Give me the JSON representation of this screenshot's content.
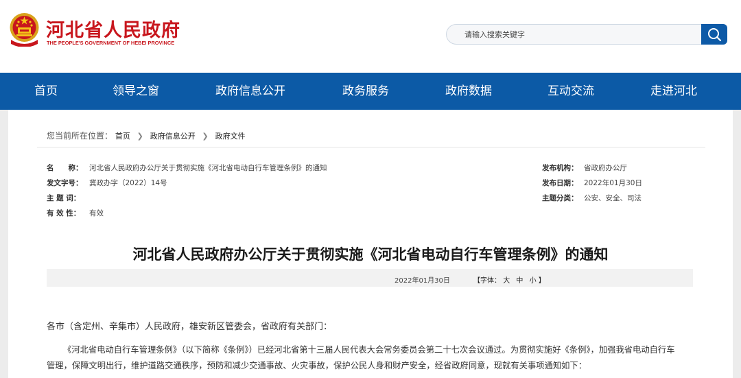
{
  "header": {
    "site_title": "河北省人民政府",
    "site_subtitle": "THE PEOPLE'S GOVERNMENT OF HEBEI PROVINCE",
    "emblem_icon": "national-emblem-icon",
    "search": {
      "placeholder": "请输入搜索关键字",
      "icon": "search-icon"
    },
    "brand_color": "#c8161d"
  },
  "nav": {
    "color": "#0c5aa6",
    "items": [
      {
        "label": "首页"
      },
      {
        "label": "领导之窗"
      },
      {
        "label": "政府信息公开"
      },
      {
        "label": "政务服务"
      },
      {
        "label": "政府数据"
      },
      {
        "label": "互动交流"
      },
      {
        "label": "走进河北"
      }
    ]
  },
  "breadcrumb": {
    "prefix": "您当前所在位置：",
    "items": [
      {
        "label": "首页"
      },
      {
        "label": "政府信息公开"
      },
      {
        "label": "政府文件"
      }
    ],
    "separator_icon": "chevron-right-icon"
  },
  "meta": {
    "name": {
      "label": "名　　称：",
      "value": "河北省人民政府办公厅关于贯彻实施《河北省电动自行车管理条例》的通知"
    },
    "doc_no": {
      "label": "发文字号：",
      "value": "冀政办字（2022）14号"
    },
    "subject": {
      "label": "主 题 词：",
      "value": ""
    },
    "validity": {
      "label": "有 效 性：",
      "value": "有效"
    },
    "issuer": {
      "label": "发布机构：",
      "value": "省政府办公厅"
    },
    "date": {
      "label": "发布日期：",
      "value": "2022年01月30日"
    },
    "category": {
      "label": "主题分类：",
      "value": "公安、安全、司法"
    }
  },
  "document": {
    "title": "河北省人民政府办公厅关于贯彻实施《河北省电动自行车管理条例》的通知",
    "date": "2022年01月30日",
    "font_size": {
      "prefix": "【字体：",
      "large": "大",
      "medium": "中",
      "small": "小",
      "suffix": "】"
    },
    "salutation": "各市（含定州、辛集市）人民政府，雄安新区管委会，省政府有关部门：",
    "para1_line1": "《河北省电动自行车管理条例》（以下简称《条例》）已经河北省第十三届人民代表大会常务委员会第二十七次会议通过。为贯彻实施好《条例》，加强我省电动自行车",
    "para1_line2": "管理，保障文明出行，维护道路交通秩序，预防和减少交通事故、火灾事故，保护公民人身和财产安全，经省政府同意，现就有关事项通知如下："
  }
}
